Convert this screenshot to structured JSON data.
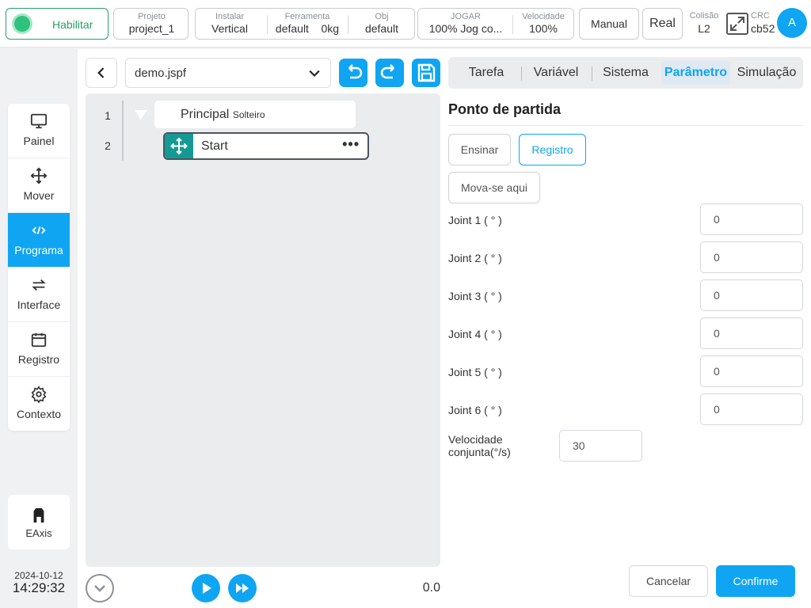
{
  "topbar": {
    "enable_label": "Habilitar",
    "project": {
      "label": "Projeto",
      "value": "project_1"
    },
    "install": {
      "label": "Instalar",
      "value": "Vertical"
    },
    "tool": {
      "label": "Ferramenta",
      "value": "default",
      "weight": "0kg"
    },
    "obj": {
      "label": "Obj",
      "value": "default"
    },
    "jog": {
      "label": "JOGAR",
      "value": "100%  Jog co..."
    },
    "speed": {
      "label": "Velocidade",
      "value": "100%"
    },
    "mode_label": "Manual",
    "real_label": "Real",
    "collision": {
      "label": "Colisão",
      "value": "L2"
    },
    "crc": {
      "label": "CRC",
      "value": "cb52"
    },
    "avatar_letter": "A"
  },
  "sidebar": {
    "items": [
      {
        "label": "Painel",
        "icon": "monitor-icon"
      },
      {
        "label": "Mover",
        "icon": "move-icon"
      },
      {
        "label": "Programa",
        "icon": "code-icon",
        "active": true
      },
      {
        "label": "Interface",
        "icon": "swap-icon"
      },
      {
        "label": "Registro",
        "icon": "calendar-icon"
      },
      {
        "label": "Contexto",
        "icon": "gear-icon"
      }
    ],
    "eaxis_label": "EAxis",
    "date": "2024-10-12",
    "time": "14:29:32"
  },
  "program": {
    "file": "demo.jspf",
    "lines": [
      {
        "num": "1",
        "title": "Principal",
        "sub": "Solteiro"
      },
      {
        "num": "2",
        "title": "Start"
      }
    ],
    "speed_value": "0.0"
  },
  "tabs": [
    "Tarefa",
    "Variável",
    "Sistema",
    "Parâmetro",
    "Simulação"
  ],
  "params": {
    "title": "Ponto de partida",
    "teach_label": "Ensinar",
    "record_label": "Registro",
    "move_here_label": "Mova-se aqui",
    "joints": [
      {
        "label": "Joint 1 ( ° )",
        "value": "0"
      },
      {
        "label": "Joint 2 ( ° )",
        "value": "0"
      },
      {
        "label": "Joint 3 ( ° )",
        "value": "0"
      },
      {
        "label": "Joint 4 ( ° )",
        "value": "0"
      },
      {
        "label": "Joint 5 ( ° )",
        "value": "0"
      },
      {
        "label": "Joint 6 ( ° )",
        "value": "0"
      }
    ],
    "joint_speed_label_1": "Velocidade",
    "joint_speed_label_2": "conjunta(°/s)",
    "joint_speed_value": "30",
    "cancel_label": "Cancelar",
    "confirm_label": "Confirme"
  },
  "colors": {
    "accent": "#0fa5f2",
    "enable": "#27a06b",
    "node": "#149a94"
  }
}
